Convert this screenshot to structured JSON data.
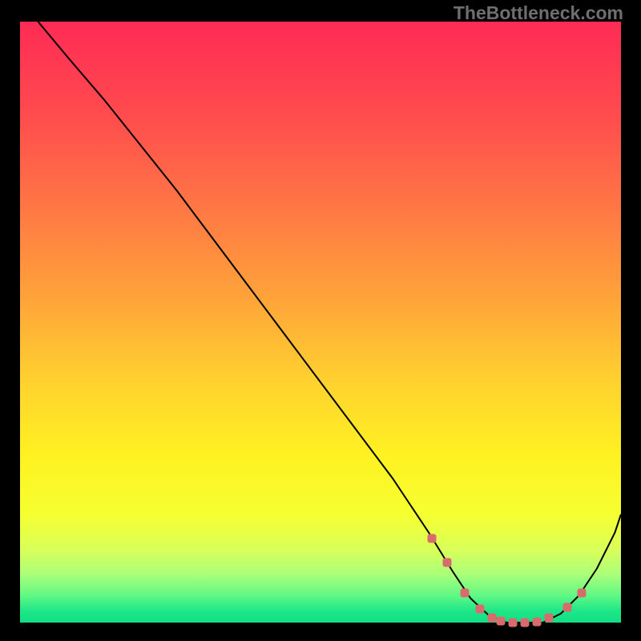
{
  "watermark": "TheBottleneck.com",
  "chart_data": {
    "type": "line",
    "title": "",
    "xlabel": "",
    "ylabel": "",
    "xlim": [
      0,
      100
    ],
    "ylim": [
      0,
      100
    ],
    "series": [
      {
        "name": "bottleneck-curve",
        "x": [
          3,
          8,
          14,
          20,
          26,
          32,
          38,
          44,
          50,
          56,
          62,
          68,
          72,
          75,
          78,
          81,
          84,
          87,
          90,
          93,
          96,
          99,
          100
        ],
        "y": [
          100,
          94,
          87,
          79.5,
          72,
          64,
          56,
          48,
          40,
          32,
          24,
          15,
          8.5,
          4,
          1.2,
          0,
          0,
          0,
          1.5,
          4.5,
          9,
          15,
          18
        ]
      }
    ],
    "markers": {
      "name": "sweet-spot-markers",
      "points": [
        {
          "x": 68.5,
          "y": 14
        },
        {
          "x": 71,
          "y": 10
        },
        {
          "x": 74,
          "y": 5
        },
        {
          "x": 76.5,
          "y": 2.3
        },
        {
          "x": 78.5,
          "y": 0.8
        },
        {
          "x": 80,
          "y": 0.3
        },
        {
          "x": 82,
          "y": 0
        },
        {
          "x": 84,
          "y": 0
        },
        {
          "x": 86,
          "y": 0.2
        },
        {
          "x": 88,
          "y": 0.8
        },
        {
          "x": 91,
          "y": 2.5
        },
        {
          "x": 93.5,
          "y": 5
        }
      ]
    },
    "gradient_stops": [
      {
        "offset": 0,
        "color": "#ff2b55"
      },
      {
        "offset": 0.15,
        "color": "#ff4a4e"
      },
      {
        "offset": 0.3,
        "color": "#ff7445"
      },
      {
        "offset": 0.45,
        "color": "#ffa03a"
      },
      {
        "offset": 0.6,
        "color": "#ffd22f"
      },
      {
        "offset": 0.72,
        "color": "#fff122"
      },
      {
        "offset": 0.82,
        "color": "#f6ff30"
      },
      {
        "offset": 0.88,
        "color": "#d8ff5a"
      },
      {
        "offset": 0.92,
        "color": "#aaff7a"
      },
      {
        "offset": 0.955,
        "color": "#60f884"
      },
      {
        "offset": 0.98,
        "color": "#20e788"
      },
      {
        "offset": 1.0,
        "color": "#0fdf86"
      }
    ]
  }
}
